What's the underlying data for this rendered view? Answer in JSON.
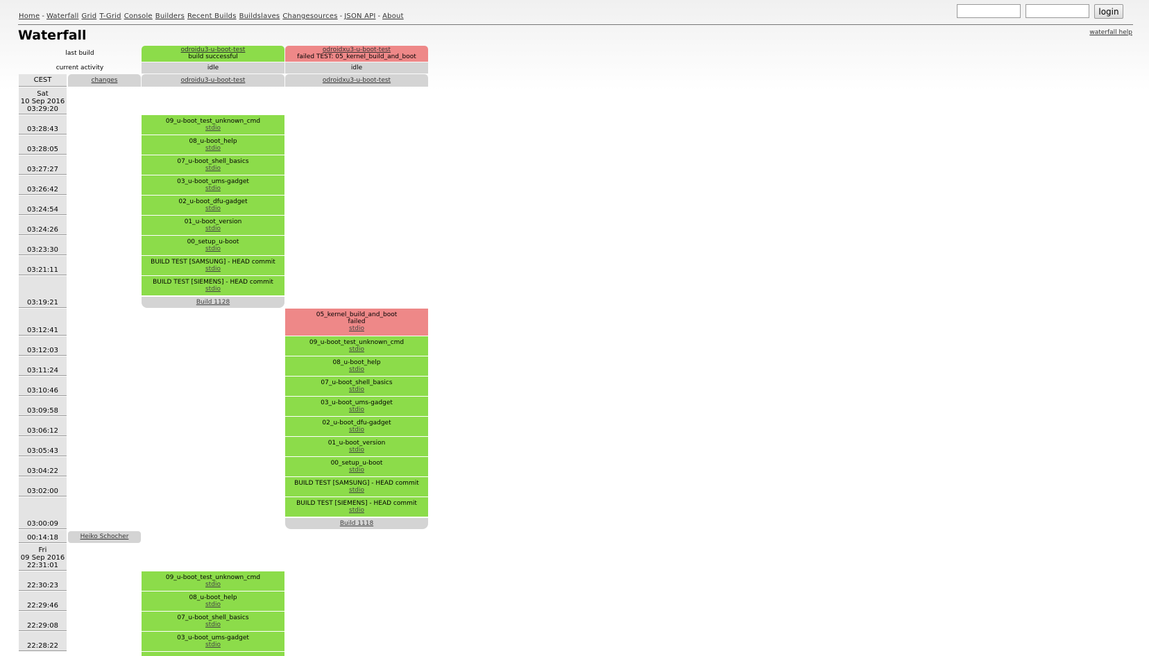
{
  "nav": {
    "links": [
      "Home",
      "Waterfall",
      "Grid",
      "T-Grid",
      "Console",
      "Builders",
      "Recent Builds",
      "Buildslaves",
      "Changesources",
      "JSON API",
      "About"
    ],
    "login_label": "login"
  },
  "page": {
    "title": "Waterfall",
    "help_link": "waterfall help"
  },
  "rows": {
    "last_build": "last build",
    "current_activity": "current activity",
    "timezone": "CEST",
    "changes": "changes"
  },
  "builders": [
    {
      "name": "odroidu3-u-boot-test",
      "last_build": "build successful",
      "activity": "idle",
      "status_color": "#8cdc4a"
    },
    {
      "name": "odroidxu3-u-boot-test",
      "last_build": "failed TEST: 05_kernel_build_and_boot",
      "activity": "idle",
      "status_color": "#ee8888"
    }
  ],
  "times": [
    {
      "day": "Sat",
      "date": "10 Sep 2016",
      "time": "03:29:20"
    },
    {
      "time": "03:28:43"
    },
    {
      "time": "03:28:05"
    },
    {
      "time": "03:27:27"
    },
    {
      "time": "03:26:42"
    },
    {
      "time": "03:24:54"
    },
    {
      "time": "03:24:26"
    },
    {
      "time": "03:23:30"
    },
    {
      "time": "03:21:11"
    },
    {
      "time": "03:19:21"
    },
    {
      "time": "03:12:41"
    },
    {
      "time": "03:12:03"
    },
    {
      "time": "03:11:24"
    },
    {
      "time": "03:10:46"
    },
    {
      "time": "03:09:58"
    },
    {
      "time": "03:06:12"
    },
    {
      "time": "03:05:43"
    },
    {
      "time": "03:04:22"
    },
    {
      "time": "03:02:00"
    },
    {
      "time": "03:00:09"
    },
    {
      "time": "00:14:18"
    },
    {
      "day": "Fri",
      "date": "09 Sep 2016",
      "time": "22:31:01"
    },
    {
      "time": "22:30:23"
    },
    {
      "time": "22:29:46"
    },
    {
      "time": "22:29:08"
    },
    {
      "time": "22:28:22"
    }
  ],
  "change_author": "Heiko Schocher",
  "build_u3_1128": {
    "steps": [
      {
        "name": "09_u-boot_test_unknown_cmd",
        "log": "stdio"
      },
      {
        "name": "08_u-boot_help",
        "log": "stdio"
      },
      {
        "name": "07_u-boot_shell_basics",
        "log": "stdio"
      },
      {
        "name": "03_u-boot_ums-gadget",
        "log": "stdio"
      },
      {
        "name": "02_u-boot_dfu-gadget",
        "log": "stdio"
      },
      {
        "name": "01_u-boot_version",
        "log": "stdio"
      },
      {
        "name": "00_setup_u-boot",
        "log": "stdio"
      },
      {
        "name": "BUILD TEST [SAMSUNG] - HEAD commit",
        "log": "stdio"
      },
      {
        "name": "BUILD TEST [SIEMENS] - HEAD commit",
        "log": "stdio"
      }
    ],
    "label": "Build 1128"
  },
  "build_xu3_1118": {
    "failed_step": {
      "name": "05_kernel_build_and_boot",
      "status": "failed",
      "log": "stdio"
    },
    "steps": [
      {
        "name": "09_u-boot_test_unknown_cmd",
        "log": "stdio"
      },
      {
        "name": "08_u-boot_help",
        "log": "stdio"
      },
      {
        "name": "07_u-boot_shell_basics",
        "log": "stdio"
      },
      {
        "name": "03_u-boot_ums-gadget",
        "log": "stdio"
      },
      {
        "name": "02_u-boot_dfu-gadget",
        "log": "stdio"
      },
      {
        "name": "01_u-boot_version",
        "log": "stdio"
      },
      {
        "name": "00_setup_u-boot",
        "log": "stdio"
      },
      {
        "name": "BUILD TEST [SAMSUNG] - HEAD commit",
        "log": "stdio"
      },
      {
        "name": "BUILD TEST [SIEMENS] - HEAD commit",
        "log": "stdio"
      }
    ],
    "label": "Build 1118"
  },
  "build_u3_prev": {
    "steps": [
      {
        "name": "09_u-boot_test_unknown_cmd",
        "log": "stdio"
      },
      {
        "name": "08_u-boot_help",
        "log": "stdio"
      },
      {
        "name": "07_u-boot_shell_basics",
        "log": "stdio"
      },
      {
        "name": "03_u-boot_ums-gadget",
        "log": "stdio"
      }
    ]
  }
}
